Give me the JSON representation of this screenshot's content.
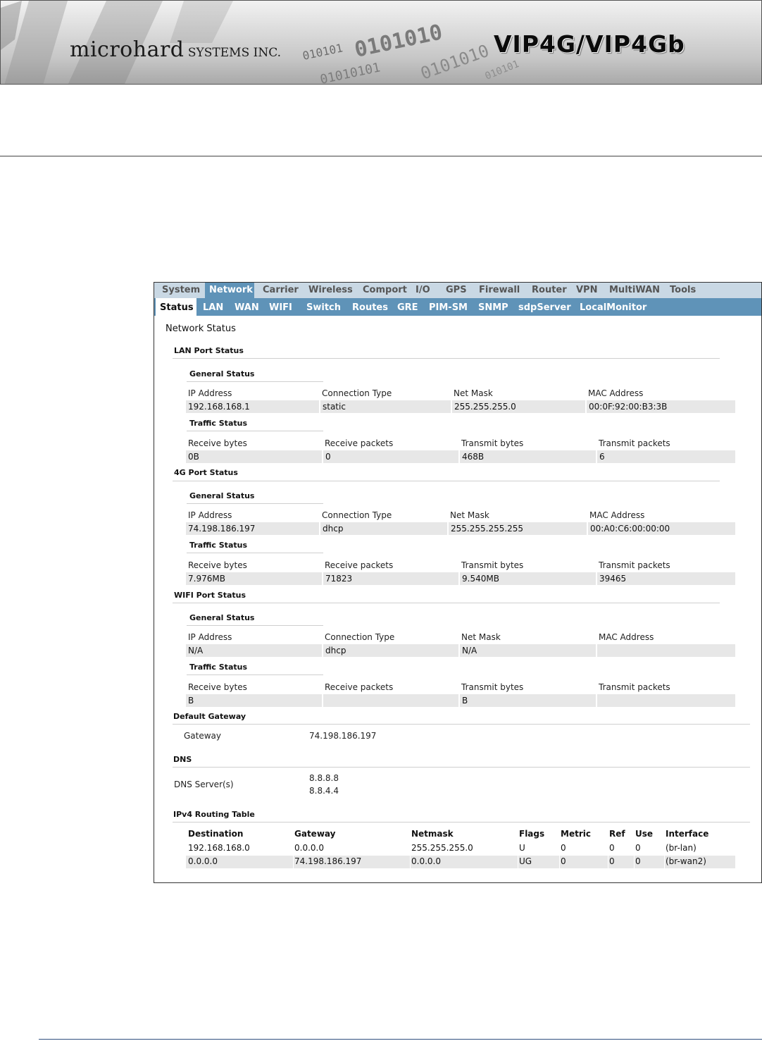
{
  "header": {
    "brand_main": "microhard",
    "brand_sub": " SYSTEMS INC.",
    "product": "VIP4G/VIP4Gb",
    "binary_art": [
      "010101",
      "0101010",
      "01010101",
      "0101010",
      "010101"
    ]
  },
  "top_menu": [
    "System",
    "Network",
    "Carrier",
    "Wireless",
    "Comport",
    "I/O",
    "GPS",
    "Firewall",
    "Router",
    "VPN",
    "MultiWAN",
    "Tools"
  ],
  "top_menu_active": "Network",
  "sub_menu": [
    "Status",
    "LAN",
    "WAN",
    "WIFI",
    "Switch",
    "Routes",
    "GRE",
    "PIM-SM",
    "SNMP",
    "sdpServer",
    "LocalMonitor"
  ],
  "sub_menu_active": "Status",
  "page_title": "Network Status",
  "general_status_label": "General Status",
  "traffic_status_label": "Traffic Status",
  "general_headers": [
    "IP Address",
    "Connection Type",
    "Net Mask",
    "MAC Address"
  ],
  "traffic_headers": [
    "Receive bytes",
    "Receive packets",
    "Transmit bytes",
    "Transmit packets"
  ],
  "lan": {
    "title": "LAN Port Status",
    "general": [
      "192.168.168.1",
      "static",
      "255.255.255.0",
      "00:0F:92:00:B3:3B"
    ],
    "traffic": [
      "0B",
      "0",
      "468B",
      "6"
    ]
  },
  "g4": {
    "title": "4G Port Status",
    "general": [
      "74.198.186.197",
      "dhcp",
      "255.255.255.255",
      "00:A0:C6:00:00:00"
    ],
    "traffic": [
      "7.976MB",
      "71823",
      "9.540MB",
      "39465"
    ]
  },
  "wifi": {
    "title": "WIFI Port Status",
    "general": [
      "N/A",
      "dhcp",
      "N/A",
      ""
    ],
    "traffic": [
      "B",
      "",
      "B",
      ""
    ]
  },
  "gateway": {
    "title": "Default Gateway",
    "label": "Gateway",
    "value": "74.198.186.197"
  },
  "dns": {
    "title": "DNS",
    "label": "DNS Server(s)",
    "servers": [
      "8.8.8.8",
      "8.8.4.4"
    ]
  },
  "routing": {
    "title": "IPv4 Routing Table",
    "headers": [
      "Destination",
      "Gateway",
      "Netmask",
      "Flags",
      "Metric",
      "Ref",
      "Use",
      "Interface"
    ],
    "rows": [
      [
        "192.168.168.0",
        "0.0.0.0",
        "255.255.255.0",
        "U",
        "0",
        "0",
        "0",
        "(br-lan)"
      ],
      [
        "0.0.0.0",
        "74.198.186.197",
        "0.0.0.0",
        "UG",
        "0",
        "0",
        "0",
        "(br-wan2)"
      ]
    ]
  }
}
